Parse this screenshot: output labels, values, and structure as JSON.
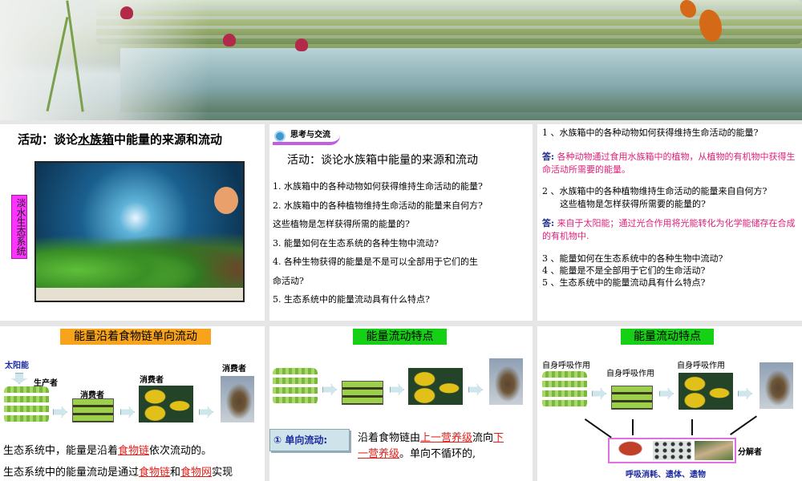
{
  "panel1": {
    "title_prefix": "活动：谈论",
    "title_underlined": "水族箱",
    "title_suffix": "中能量的来源和流动",
    "side_label": "淡水生态系统"
  },
  "panel2": {
    "badge": "思考与交流",
    "title": "活动：谈论水族箱中能量的来源和流动",
    "questions": [
      "1. 水族箱中的各种动物如何获得维持生命活动的能量?",
      "2. 水族箱中的各种植物维持生命活动的能量来自何方?",
      "这些植物是怎样获得所需的能量的?",
      "3. 能量如何在生态系统的各种生物中流动?",
      "4. 各种生物获得的能量是不是可以全部用于它们的生",
      "命活动?",
      "5. 生态系统中的能量流动具有什么特点?"
    ]
  },
  "panel3": {
    "q1": "1 、水族箱中的各种动物如何获得维持生命活动的能量?",
    "a_label": "答:",
    "a1": "各种动物通过食用水族箱中的植物，从植物的有机物中获得生命活动所需要的能量。",
    "q2a": "2 、水族箱中的各种植物维持生命活动的能量来自自何方?",
    "q2b": "这些植物是怎样获得所需要的能量的?",
    "a2": "来自于太阳能；通过光合作用将光能转化为化学能储存在合成的有机物中.",
    "q3": "3 、能量如何在生态系统中的各种生物中流动?",
    "q4": "4 、能量是不是全部用于它们的生命活动?",
    "q5": "5 、生态系统中的能量流动具有什么特点?"
  },
  "panel4": {
    "header": "能量沿着食物链单向流动",
    "sun": "太阳能",
    "producer": "生产者",
    "consumer": "消费者",
    "line1_a": "生态系统中，能量是沿着",
    "line1_red": "食物链",
    "line1_b": "依次流动的。",
    "line2_a": "生态系统中的能量流动是通过",
    "line2_red1": "食物链",
    "line2_and": "和",
    "line2_red2": "食物网",
    "line2_b": "实现"
  },
  "panel5": {
    "header": "能量流动特点",
    "tag": "① 单向流动:",
    "text_a": "沿着食物链由",
    "red1": "上一营养级",
    "text_b": "流向",
    "red2a": "下",
    "red2b": "一营养级",
    "text_c": "。单向不循环的,"
  },
  "panel6": {
    "header": "能量流动特点",
    "resp": "自身呼吸作用",
    "decomposer": "分解者",
    "bottom": "呼吸消耗、遗体、遗物"
  }
}
